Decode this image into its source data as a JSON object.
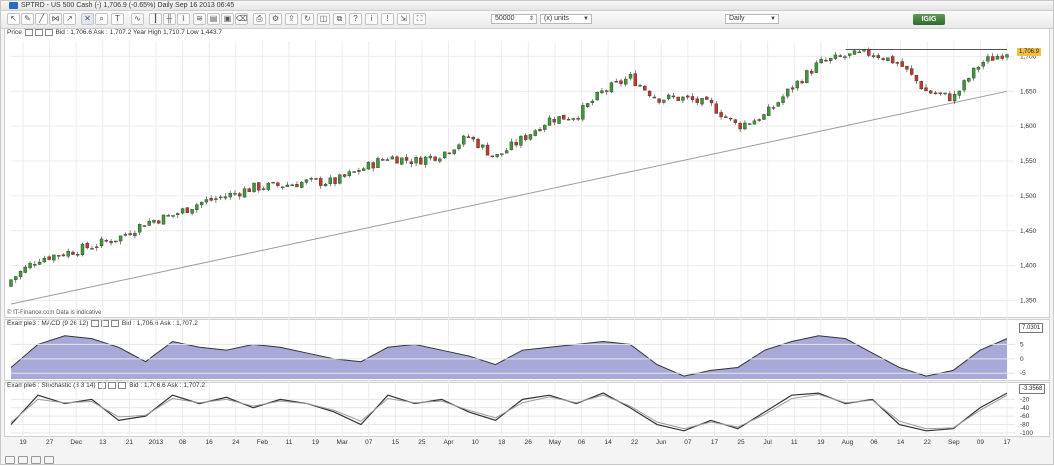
{
  "window": {
    "title": "SPTRD - US 500 Cash (-)   1,706.9 (-0.65%)   Daily   Sep 16 2013 06:45"
  },
  "toolbar": {
    "quantity_value": "50000",
    "units_value": "(x) units",
    "timeframe_value": "Daily",
    "logo_text": "IGIG"
  },
  "price_panel": {
    "header_name": "Price",
    "header_info": "Bid : 1,706.6  Ask : 1,707.2  Year High 1,710.7  Low 1,443.7",
    "y_ticks": [
      "1,700",
      "1,650",
      "1,600",
      "1,550",
      "1,500",
      "1,450",
      "1,400",
      "1,350"
    ],
    "last_price_tag": "1,706.9",
    "source_note": "© IT-Finance.com  Data is indicative"
  },
  "macd_panel": {
    "header_name": "Example3 : MACD (9 26 12)",
    "header_info": "Bid : 1,706.6  Ask : 1,707.2",
    "y_ticks": [
      "5",
      "0",
      "-5"
    ],
    "value_tag": "7.0301"
  },
  "stoch_panel": {
    "header_name": "Example6 : Stochastic (3 3 14)",
    "header_info": "Bid : 1,706.6  Ask : 1,707.2",
    "y_ticks": [
      "-20",
      "-40",
      "-60",
      "-80",
      "-100"
    ],
    "value_tag": "-3.3568"
  },
  "x_axis": {
    "labels": [
      "19",
      "27",
      "Dec",
      "13",
      "21",
      "2013",
      "08",
      "16",
      "24",
      "Feb",
      "11",
      "19",
      "Mar",
      "07",
      "15",
      "25",
      "Apr",
      "10",
      "18",
      "26",
      "May",
      "06",
      "14",
      "22",
      "Jun",
      "07",
      "17",
      "25",
      "Jul",
      "11",
      "19",
      "Aug",
      "06",
      "14",
      "22",
      "Sep",
      "09",
      "17"
    ]
  },
  "colors": {
    "up_candle": "#3c9a34",
    "down_candle": "#c0392b",
    "macd_fill": "#a9a9d9",
    "macd_line": "#333333",
    "stoch_k": "#333333",
    "stoch_d": "#9a9a9a",
    "trend_line": "#9a9a9a",
    "resistance_line": "#555555",
    "price_tag_bg": "#f0c040"
  },
  "chart_data": [
    {
      "type": "line",
      "subtype": "candlestick",
      "title": "SPTRD - US 500 Cash (-)",
      "x": [
        "Nov 19",
        "Nov 27",
        "Dec 05",
        "Dec 13",
        "Dec 21",
        "Jan 02",
        "Jan 08",
        "Jan 16",
        "Jan 24",
        "Feb 01",
        "Feb 11",
        "Feb 19",
        "Mar 01",
        "Mar 07",
        "Mar 15",
        "Mar 25",
        "Apr 02",
        "Apr 10",
        "Apr 18",
        "Apr 26",
        "May 03",
        "May 06",
        "May 14",
        "May 22",
        "Jun 03",
        "Jun 07",
        "Jun 17",
        "Jun 25",
        "Jul 03",
        "Jul 11",
        "Jul 19",
        "Aug 01",
        "Aug 06",
        "Aug 14",
        "Aug 22",
        "Sep 03",
        "Sep 09",
        "Sep 16"
      ],
      "series": [
        {
          "name": "Close",
          "values": [
            1380,
            1410,
            1418,
            1428,
            1440,
            1462,
            1472,
            1490,
            1500,
            1512,
            1515,
            1520,
            1520,
            1538,
            1556,
            1550,
            1560,
            1585,
            1555,
            1582,
            1610,
            1615,
            1650,
            1670,
            1640,
            1640,
            1630,
            1600,
            1615,
            1655,
            1690,
            1700,
            1705,
            1690,
            1650,
            1640,
            1690,
            1707
          ]
        }
      ],
      "ylim": [
        1335,
        1725
      ],
      "y_ticks": [
        1350,
        1400,
        1450,
        1500,
        1550,
        1600,
        1650,
        1700
      ],
      "trend_line": {
        "from": {
          "x": "Nov 19",
          "y": 1345
        },
        "to": {
          "x": "Sep 16",
          "y": 1650
        }
      },
      "resistance_line": {
        "from": {
          "x": "Aug 01",
          "y": 1710
        },
        "to": {
          "x": "Sep 16",
          "y": 1710
        }
      }
    },
    {
      "type": "area",
      "title": "MACD (9 26 12)",
      "x": [
        "Nov 19",
        "Nov 27",
        "Dec 05",
        "Dec 13",
        "Dec 21",
        "Jan 02",
        "Jan 08",
        "Jan 16",
        "Jan 24",
        "Feb 01",
        "Feb 11",
        "Feb 19",
        "Mar 01",
        "Mar 07",
        "Mar 15",
        "Mar 25",
        "Apr 02",
        "Apr 10",
        "Apr 18",
        "Apr 26",
        "May 03",
        "May 06",
        "May 14",
        "May 22",
        "Jun 03",
        "Jun 07",
        "Jun 17",
        "Jun 25",
        "Jul 03",
        "Jul 11",
        "Jul 19",
        "Aug 01",
        "Aug 06",
        "Aug 14",
        "Aug 22",
        "Sep 03",
        "Sep 09",
        "Sep 16"
      ],
      "series": [
        {
          "name": "MACD",
          "values": [
            -3,
            5,
            8,
            7,
            4,
            -1,
            6,
            4,
            3,
            5,
            4,
            2,
            0,
            -1,
            4,
            5,
            3,
            1,
            -2,
            3,
            4,
            5,
            6,
            5,
            -2,
            -6,
            -4,
            -3,
            3,
            6,
            8,
            7,
            2,
            -3,
            -6,
            -4,
            3,
            7
          ]
        }
      ],
      "ylim": [
        -7,
        10
      ],
      "y_ticks": [
        5,
        0,
        -5
      ]
    },
    {
      "type": "line",
      "title": "Stochastic (3 3 14)",
      "x": [
        "Nov 19",
        "Nov 27",
        "Dec 05",
        "Dec 13",
        "Dec 21",
        "Jan 02",
        "Jan 08",
        "Jan 16",
        "Jan 24",
        "Feb 01",
        "Feb 11",
        "Feb 19",
        "Mar 01",
        "Mar 07",
        "Mar 15",
        "Mar 25",
        "Apr 02",
        "Apr 10",
        "Apr 18",
        "Apr 26",
        "May 03",
        "May 06",
        "May 14",
        "May 22",
        "Jun 03",
        "Jun 07",
        "Jun 17",
        "Jun 25",
        "Jul 03",
        "Jul 11",
        "Jul 19",
        "Aug 01",
        "Aug 06",
        "Aug 14",
        "Aug 22",
        "Sep 03",
        "Sep 09",
        "Sep 16"
      ],
      "series": [
        {
          "name": "%K",
          "values": [
            -80,
            -10,
            -30,
            -20,
            -70,
            -60,
            -10,
            -30,
            -15,
            -40,
            -20,
            -30,
            -50,
            -80,
            -10,
            -30,
            -20,
            -50,
            -70,
            -20,
            -10,
            -30,
            -5,
            -40,
            -80,
            -95,
            -70,
            -90,
            -50,
            -10,
            -5,
            -30,
            -20,
            -80,
            -95,
            -90,
            -40,
            -5
          ]
        },
        {
          "name": "%D",
          "values": [
            -75,
            -20,
            -28,
            -25,
            -62,
            -58,
            -18,
            -28,
            -20,
            -36,
            -24,
            -30,
            -46,
            -72,
            -18,
            -28,
            -24,
            -46,
            -64,
            -28,
            -14,
            -28,
            -10,
            -36,
            -74,
            -90,
            -74,
            -86,
            -56,
            -18,
            -8,
            -28,
            -22,
            -72,
            -90,
            -88,
            -46,
            -10
          ]
        }
      ],
      "ylim": [
        -105,
        0
      ],
      "y_ticks": [
        -20,
        -40,
        -60,
        -80,
        -100
      ]
    }
  ]
}
